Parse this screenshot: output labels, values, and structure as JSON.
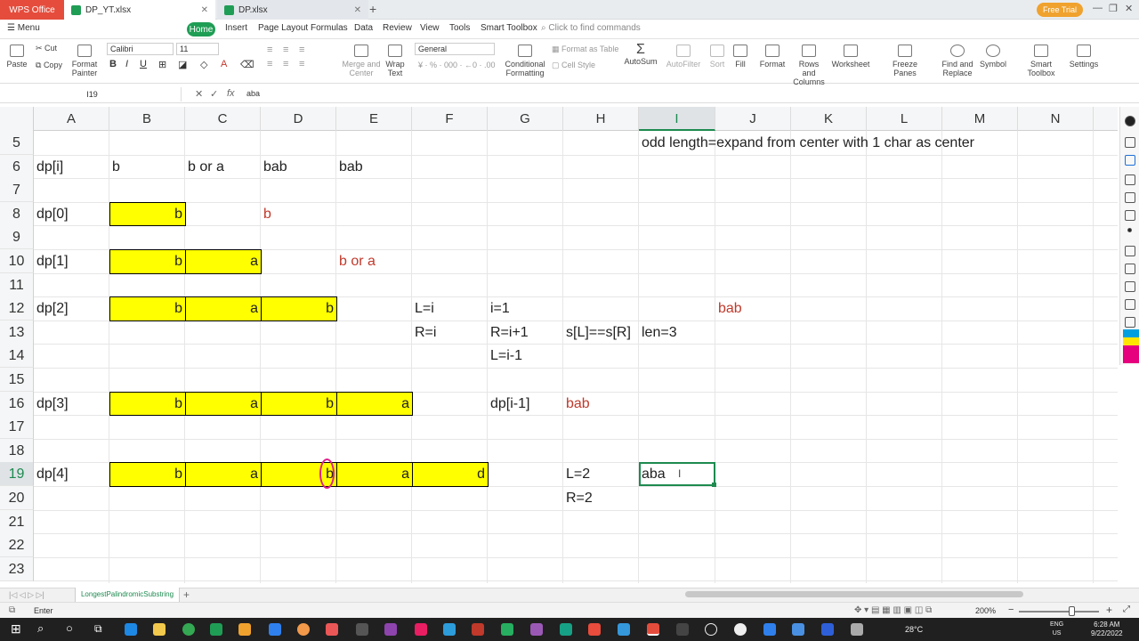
{
  "titlebar": {
    "wps_label": "WPS Office",
    "tabs": [
      {
        "label": "DP_YT.xlsx"
      },
      {
        "label": "DP.xlsx"
      }
    ],
    "free_trial": "Free Trial"
  },
  "menu": {
    "menu_label": "Menu",
    "items": [
      "Home",
      "Insert",
      "Page Layout",
      "Formulas",
      "Data",
      "Review",
      "View",
      "Tools",
      "Smart Toolbox"
    ],
    "search_placeholder": "Click to find commands"
  },
  "ribbon": {
    "cut": "Cut",
    "copy": "Copy",
    "paste": "Paste",
    "format_painter": "Format Painter",
    "font_name": "Calibri",
    "font_size": "11",
    "merge_center": "Merge and Center",
    "wrap_text": "Wrap Text",
    "number_format": "General",
    "conditional_formatting": "Conditional Formatting",
    "format_as_table": "Format as Table",
    "cell_style": "Cell Style",
    "autosum": "AutoSum",
    "autofilter": "AutoFilter",
    "sort": "Sort",
    "fill": "Fill",
    "format": "Format",
    "rows_columns": "Rows and Columns",
    "worksheet": "Worksheet",
    "freeze_panes": "Freeze Panes",
    "find_replace": "Find and Replace",
    "symbol": "Symbol",
    "smart_toolbox": "Smart Toolbox",
    "settings": "Settings"
  },
  "formula_bar": {
    "name_box": "I19",
    "formula": "aba"
  },
  "grid": {
    "columns": [
      "A",
      "B",
      "C",
      "D",
      "E",
      "F",
      "G",
      "H",
      "I",
      "J",
      "K",
      "L",
      "M",
      "N"
    ],
    "selected_column": "I",
    "rows": [
      "5",
      "6",
      "7",
      "8",
      "9",
      "10",
      "11",
      "12",
      "13",
      "14",
      "15",
      "16",
      "17",
      "18",
      "19",
      "20",
      "21",
      "22",
      "23"
    ],
    "selected_row": "19",
    "cells": {
      "I5": "odd length=expand from center with 1 char as center",
      "A6": "dp[i]",
      "B6": "b",
      "C6": "b or a",
      "D6": "bab",
      "E6": "bab",
      "A8": "dp[0]",
      "B8": "b",
      "D8": "b",
      "A10": "dp[1]",
      "B10": "b",
      "C10": "a",
      "E10": "b or a",
      "A12": "dp[2]",
      "B12": "b",
      "C12": "a",
      "D12": "b",
      "F12": "L=i",
      "G12": "i=1",
      "J12": "bab",
      "F13": "R=i",
      "G13": "R=i+1",
      "H13": "s[L]==s[R]",
      "I13": "len=3",
      "G14": "L=i-1",
      "A16": "dp[3]",
      "B16": "b",
      "C16": "a",
      "D16": "b",
      "E16": "a",
      "G16": "dp[i-1]",
      "H16": "bab",
      "A19": "dp[4]",
      "B19": "b",
      "C19": "a",
      "D19": "b",
      "E19": "a",
      "F19": "d",
      "H19": "L=2",
      "I19": "aba",
      "H20": "R=2"
    }
  },
  "sheet": {
    "tab_name": "LongestPalindromicSubstring"
  },
  "status": {
    "mode": "Enter",
    "zoom": "200%"
  },
  "taskbar": {
    "weather": "28°C",
    "lang_top": "ENG",
    "lang_bottom": "US",
    "time": "6:28 AM",
    "date": "9/22/2022"
  },
  "colors": {
    "accent": "#1d8a4f",
    "highlight": "#ffff00",
    "red_text": "#c0392b",
    "marker": "#e0208c"
  }
}
